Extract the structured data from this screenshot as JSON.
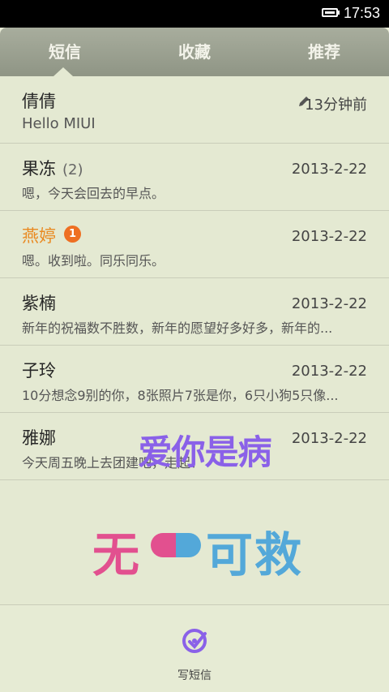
{
  "status": {
    "time": "17:53"
  },
  "tabs": [
    {
      "label": "短信"
    },
    {
      "label": "收藏"
    },
    {
      "label": "推荐"
    }
  ],
  "messages": [
    {
      "name": "倩倩",
      "time": "13分钟前",
      "preview": "Hello MIUI"
    },
    {
      "name": "果冻",
      "count": "(2)",
      "time": "2013-2-22",
      "preview": "嗯，今天会回去的早点。"
    },
    {
      "name": "燕婷",
      "badge": "1",
      "time": "2013-2-22",
      "preview": "嗯。收到啦。同乐同乐。"
    },
    {
      "name": "紫楠",
      "time": "2013-2-22",
      "preview": "新年的祝福数不胜数，新年的愿望好多好多，新年的..."
    },
    {
      "name": "子玲",
      "time": "2013-2-22",
      "preview": "10分想念9别的你，8张照片7张是你，6只小狗5只像..."
    },
    {
      "name": "雅娜",
      "time": "2013-2-22",
      "preview": "今天周五晚上去团建吧，走起！"
    }
  ],
  "overlay": {
    "line1": "爱你是病",
    "line2_a": "无",
    "line2_b": "可",
    "line2_c": "救"
  },
  "bottom": {
    "compose_label": "写短信"
  },
  "colors": {
    "accent": "#e98a22",
    "badge": "#ee6f22",
    "compose": "#8a61e8"
  }
}
